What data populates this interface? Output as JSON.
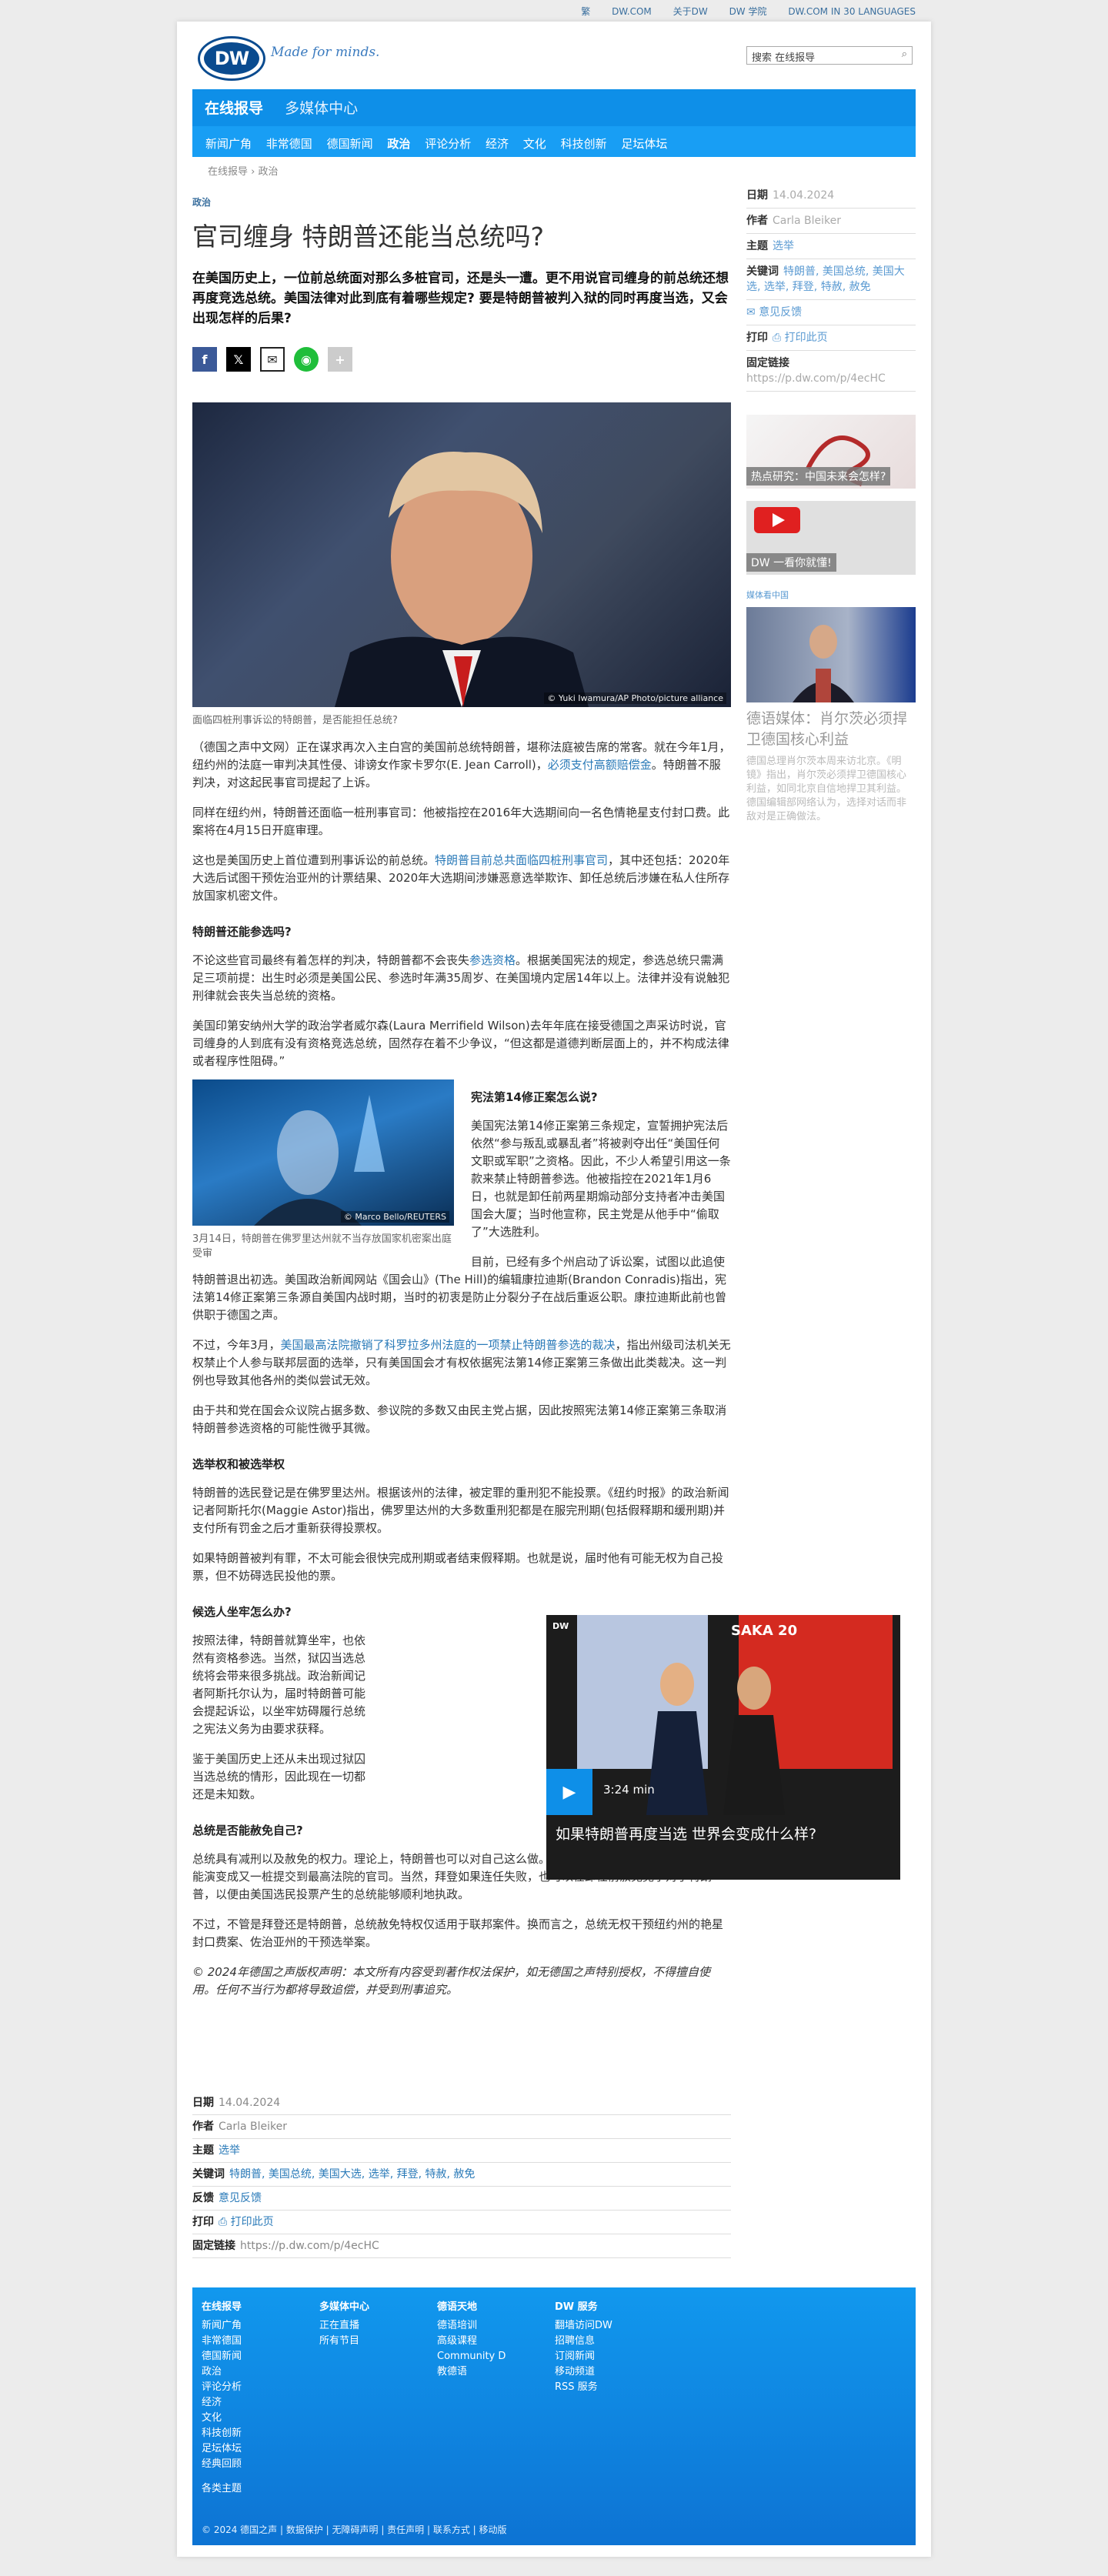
{
  "topbar": {
    "links": [
      "繁",
      "DW.COM",
      "关于DW",
      "DW 学院",
      "DW.COM IN 30 LANGUAGES"
    ]
  },
  "header": {
    "logo": "DW",
    "tagline": "Made for minds.",
    "search_placeholder": "搜索 在线报导"
  },
  "nav": {
    "primary": "在线报导",
    "secondary": "多媒体中心",
    "sub": [
      "新闻广角",
      "非常德国",
      "德国新闻",
      "政治",
      "评论分析",
      "经济",
      "文化",
      "科技创新",
      "足坛体坛"
    ],
    "active": "政治"
  },
  "breadcrumb": "在线报导 › 政治",
  "article": {
    "rubric": "政治",
    "title": "官司缠身 特朗普还能当总统吗?",
    "lead": "在美国历史上，一位前总统面对那么多桩官司，还是头一遭。更不用说官司缠身的前总统还想再度竞选总统。美国法律对此到底有着哪些规定? 要是特朗普被判入狱的同时再度当选，又会出现怎样的后果?",
    "hero_caption": "面临四桩刑事诉讼的特朗普，是否能担任总统?",
    "hero_credit": "© Yuki Iwamura/AP Photo/picture alliance",
    "p1": "（德国之声中文网）正在谋求再次入主白宫的美国前总统特朗普，堪称法庭被告席的常客。就在今年1月，纽约州的法庭一审判决其性侵、诽谤女作家卡罗尔(E. Jean Carroll)，",
    "p1_link": "必须支付高额赔偿金",
    "p1_end": "。特朗普不服判决，对这起民事官司提起了上诉。",
    "p2": "同样在纽约州，特朗普还面临一桩刑事官司：他被指控在2016年大选期间向一名色情艳星支付封口费。此案将在4月15日开庭审理。",
    "p3": "这也是美国历史上首位遭到刑事诉讼的前总统。",
    "p3_link": "特朗普目前总共面临四桩刑事官司",
    "p3_end": "，其中还包括：2020年大选后试图干预佐治亚州的计票结果、2020年大选期间涉嫌恶意选举欺诈、卸任总统后涉嫌在私人住所存放国家机密文件。",
    "h_a": "特朗普还能参选吗?",
    "p4": "不论这些官司最终有着怎样的判决，特朗普都不会丧失",
    "p4_link": "参选资格",
    "p4_end": "。根据美国宪法的规定，参选总统只需满足三项前提：出生时必须是美国公民、参选时年满35周岁、在美国境内定居14年以上。法律并没有说触犯刑律就会丧失当总统的资格。",
    "p5": "美国印第安纳州大学的政治学者威尔森(Laura Merrifield Wilson)去年年底在接受德国之声采访时说，官司缠身的人到底有没有资格竞选总统，固然存在着不少争议，“但这都是道德判断层面上的，并不构成法律或者程序性阻碍。”",
    "inline_caption": "3月14日，特朗普在佛罗里达州就不当存放国家机密案出庭受审",
    "inline_credit": "© Marco Bello/REUTERS",
    "h_b": "宪法第14修正案怎么说?",
    "p6": "美国宪法第14修正案第三条规定，宣誓拥护宪法后依然“参与叛乱或暴乱者”将被剥夺出任“美国任何文职或军职”之资格。因此，不少人希望引用这一条款来禁止特朗普参选。他被指控在2021年1月6日，也就是卸任前两星期煽动部分支持者冲击美国国会大厦；当时他宣称，民主党是从他手中“偷取了”大选胜利。",
    "p7": "目前，已经有多个州启动了诉讼案，试图以此追使特朗普退出初选。美国政治新闻网站《国会山》(The Hill)的编辑康拉迪斯(Brandon Conradis)指出，宪法第14修正案第三条源自美国内战时期，当时的初衷是防止分裂分子在战后重返公职。康拉迪斯此前也曾供职于德国之声。",
    "p8": "不过，今年3月，",
    "p8_link": "美国最高法院撤销了科罗拉多州法庭的一项禁止特朗普参选的裁决",
    "p8_end": "，指出州级司法机关无权禁止个人参与联邦层面的选举，只有美国国会才有权依据宪法第14修正案第三条做出此类裁决。这一判例也导致其他各州的类似尝试无效。",
    "p9": "由于共和党在国会众议院占据多数、参议院的多数又由民主党占据，因此按照宪法第14修正案第三条取消特朗普参选资格的可能性微乎其微。",
    "h_c": "选举权和被选举权",
    "p10": "特朗普的选民登记是在佛罗里达州。根据该州的法律，被定罪的重刑犯不能投票。《纽约时报》的政治新闻记者阿斯托尔(Maggie Astor)指出，佛罗里达州的大多数重刑犯都是在服完刑期(包括假释期和缓刑期)并支付所有罚金之后才重新获得投票权。",
    "p11": "如果特朗普被判有罪，不太可能会很快完成刑期或者结束假释期。也就是说，届时他有可能无权为自己投票，但不妨碍选民投他的票。",
    "h_d": "候选人坐牢怎么办?",
    "p12": "按照法律，特朗普就算坐牢，也依然有资格参选。当然，狱囚当选总统将会带来很多挑战。政治新闻记者阿斯托尔认为，届时特朗普可能会提起诉讼，以坐牢妨碍履行总统之宪法义务为由要求获释。",
    "p13": "鉴于美国历史上还从未出现过狱囚当选总统的情形，因此现在一切都还是未知数。",
    "h_e": "总统是否能赦免自己?",
    "p14": "总统具有减刑以及赦免的权力。理论上，特朗普也可以对自己这么做。但如此极端地动用总统权力很有可能演变成又一桩提交到最高法院的官司。当然，拜登如果连任失败，也可以在卸任前赦免竞争对手特朗普，以便由美国选民投票产生的总统能够顺利地执政。",
    "p15": "不过，不管是拜登还是特朗普，总统赦免特权仅适用于联邦案件。换而言之，总统无权干预纽约州的艳星封口费案、佐治亚州的干预选举案。",
    "copyright": "© 2024年德国之声版权声明：本文所有内容受到著作权法保护，如无德国之声特别授权，不得擅自使用。任何不当行为都将导致追偿，并受到刑事追究。"
  },
  "video": {
    "duration": "3:24 min",
    "title": "如果特朗普再度当选 世界会变成什么样?",
    "sign": "SAKA 20"
  },
  "sidebar": {
    "date_label": "日期",
    "date": "14.04.2024",
    "author_label": "作者",
    "author": "Carla Bleiker",
    "topic_label": "主题",
    "topic": "选举",
    "keywords_label": "关键词",
    "keywords": "特朗普, 美国总统, 美国大选, 选举, 拜登, 特赦, 赦免",
    "feedback": "意见反馈",
    "print_label": "打印",
    "print": "打印此页",
    "permalink_label": "固定链接",
    "permalink": "https://p.dw.com/p/4ecHC",
    "promo1": "热点研究：中国未来会怎样?",
    "promo2": "DW 一看你就懂!",
    "media_center": "媒体看中国",
    "promo3_title": "德语媒体：肖尔茨必须捍卫德国核心利益",
    "promo3_text": "德国总理肖尔茨本周来访北京。《明镜》指出，肖尔茨必须捍卫德国核心利益，如同北京自信地捍卫其利益。德国编辑部网络认为，选择对话而非敌对是正确做法。"
  },
  "footmeta": {
    "date_label": "日期",
    "date": "14.04.2024",
    "author_label": "作者",
    "author": "Carla Bleiker",
    "topic_label": "主题",
    "topic": "选举",
    "keywords_label": "关键词",
    "keywords": "特朗普, 美国总统, 美国大选, 选举, 拜登, 特赦, 赦免",
    "feedback_label": "反馈",
    "feedback": "意见反馈",
    "print_label": "打印",
    "print": "打印此页",
    "permalink_label": "固定链接",
    "permalink": "https://p.dw.com/p/4ecHC"
  },
  "footer": {
    "col1": {
      "head": "在线报导",
      "items": [
        "新闻广角",
        "非常德国",
        "德国新闻",
        "政治",
        "评论分析",
        "经济",
        "文化",
        "科技创新",
        "足坛体坛",
        "经典回顾"
      ],
      "extra": "各类主题"
    },
    "col2": {
      "head": "多媒体中心",
      "items": [
        "正在直播",
        "所有节目"
      ]
    },
    "col3": {
      "head": "德语天地",
      "items": [
        "德语培训",
        "高级课程",
        "Community D",
        "教德语"
      ]
    },
    "col4": {
      "head": "DW 服务",
      "items": [
        "翻墙访问DW",
        "招聘信息",
        "订阅新闻",
        "移动频道",
        "RSS 服务"
      ]
    },
    "copyright": "© 2024 德国之声 | 数据保护 | 无障碍声明 | 责任声明 | 联系方式 | 移动版"
  }
}
